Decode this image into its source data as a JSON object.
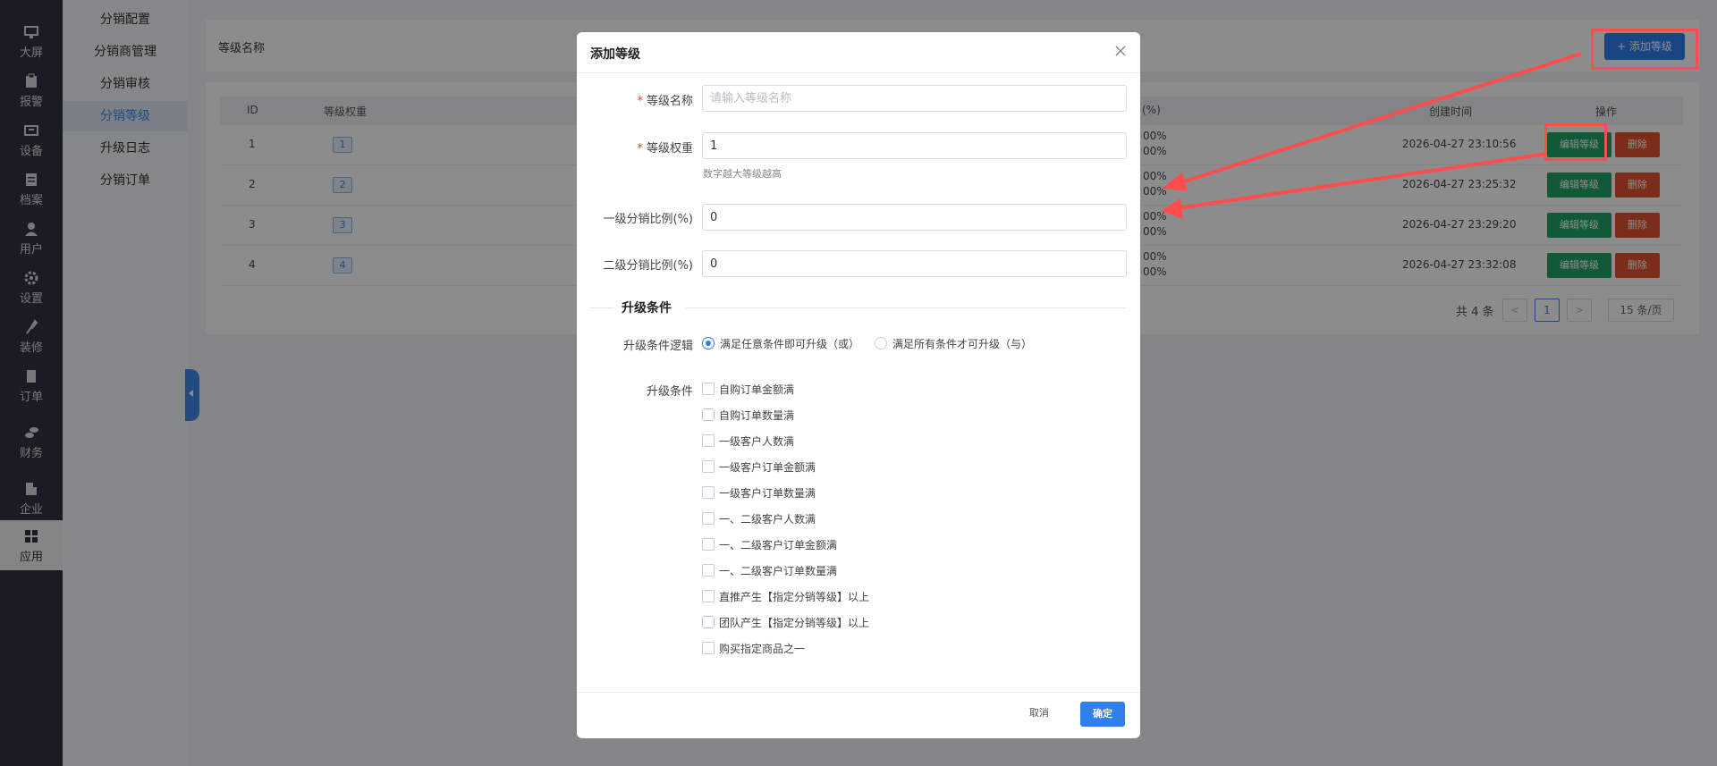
{
  "rail": {
    "items": [
      {
        "label": "大屏",
        "icon": "monitor-icon"
      },
      {
        "label": "报警",
        "icon": "clipboard-icon"
      },
      {
        "label": "设备",
        "icon": "device-icon"
      },
      {
        "label": "档案",
        "icon": "archive-icon"
      },
      {
        "label": "用户",
        "icon": "user-icon"
      },
      {
        "label": "设置",
        "icon": "gear-icon"
      },
      {
        "label": "装修",
        "icon": "brush-icon"
      },
      {
        "label": "订单",
        "icon": "order-icon"
      },
      {
        "label": "财务",
        "icon": "coins-icon"
      },
      {
        "label": "企业",
        "icon": "building-icon"
      },
      {
        "label": "应用",
        "icon": "apps-icon"
      }
    ],
    "active": "应用"
  },
  "submenu": {
    "items": [
      "分销配置",
      "分销商管理",
      "分销审核",
      "分销等级",
      "升级日志",
      "分销订单"
    ],
    "active": "分销等级"
  },
  "filter": {
    "name_label": "等级名称"
  },
  "toolbar": {
    "add_label": "+ 添加等级"
  },
  "table": {
    "headers": {
      "id": "ID",
      "weight": "等级权重",
      "ratio": "(%)",
      "created": "创建时间",
      "actions": "操作"
    },
    "rows": [
      {
        "id": "1",
        "weight": "1",
        "ratio1": "00%",
        "ratio2": "00%",
        "created": "2026-04-27 23:10:56"
      },
      {
        "id": "2",
        "weight": "2",
        "ratio1": "00%",
        "ratio2": "00%",
        "created": "2026-04-27 23:25:32"
      },
      {
        "id": "3",
        "weight": "3",
        "ratio1": "00%",
        "ratio2": "00%",
        "created": "2026-04-27 23:29:20"
      },
      {
        "id": "4",
        "weight": "4",
        "ratio1": "00%",
        "ratio2": "00%",
        "created": "2026-04-27 23:32:08"
      }
    ],
    "edit_label": "编辑等级",
    "delete_label": "删除"
  },
  "pager": {
    "total": "共 4 条",
    "prev": "<",
    "current": "1",
    "next": ">",
    "size": "15 条/页"
  },
  "dialog": {
    "title": "添加等级",
    "close_icon": "close-icon",
    "fields": {
      "name": {
        "label": "等级名称",
        "placeholder": "请输入等级名称",
        "value": ""
      },
      "weight": {
        "label": "等级权重",
        "value": "1",
        "help": "数字越大等级越高"
      },
      "level1": {
        "label": "一级分销比例(%)",
        "value": "0"
      },
      "level2": {
        "label": "二级分销比例(%)",
        "value": "0"
      }
    },
    "required_mark": "*",
    "section_title": "升级条件",
    "logic": {
      "label": "升级条件逻辑",
      "options": [
        "满足任意条件即可升级（或）",
        "满足所有条件才可升级（与）"
      ],
      "selected": 0
    },
    "conditions": {
      "label": "升级条件",
      "items": [
        "自购订单金额满",
        "自购订单数量满",
        "一级客户人数满",
        "一级客户订单金额满",
        "一级客户订单数量满",
        "一、二级客户人数满",
        "一、二级客户订单金额满",
        "一、二级客户订单数量满",
        "直推产生【指定分销等级】以上",
        "团队产生【指定分销等级】以上",
        "购买指定商品之一"
      ]
    },
    "cancel_label": "取消",
    "ok_label": "确定"
  },
  "colors": {
    "primary": "#2f80ed",
    "success": "#21a366",
    "danger": "#e2532f",
    "highlight": "#ff4d4d"
  }
}
